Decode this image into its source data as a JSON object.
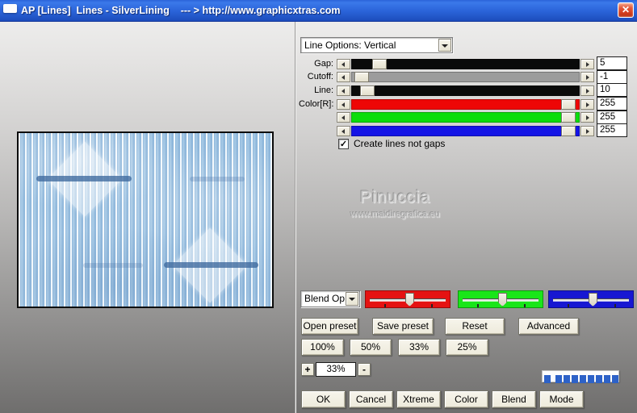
{
  "window": {
    "title": "AP [Lines]  Lines - SilverLining    --- > http://www.graphicxtras.com",
    "close_glyph": "✕"
  },
  "controls": {
    "line_options_dropdown": "Line Options: Vertical",
    "sliders": [
      {
        "label": "Gap:",
        "value": "5",
        "track_color": "#0a0a0a",
        "thumb_left": "9%"
      },
      {
        "label": "Cutoff:",
        "value": "-1",
        "track_color": "#9c9c9c",
        "thumb_left": "1%"
      },
      {
        "label": "Line:",
        "value": "10",
        "track_color": "#0a0a0a",
        "thumb_left": "3.5%"
      },
      {
        "label": "Color[R]:",
        "value": "255",
        "track_color": "#ee0606",
        "thumb_left": "92%"
      },
      {
        "label": "",
        "value": "255",
        "track_color": "#0bdd0b",
        "thumb_left": "92%"
      },
      {
        "label": "",
        "value": "255",
        "track_color": "#1414e6",
        "thumb_left": "92%"
      }
    ],
    "checkbox": {
      "label": "Create lines not gaps",
      "checked": true,
      "mark": "✓"
    }
  },
  "watermark": {
    "name": "Pinuccia",
    "site": "www.maidiregrafica.eu"
  },
  "blend": {
    "dropdown_label": "Blend Opti",
    "channels": [
      {
        "name": "red",
        "color": "#e51212",
        "thumb_left": "47%"
      },
      {
        "name": "green",
        "color": "#19e619",
        "thumb_left": "47%"
      },
      {
        "name": "blue",
        "color": "#1717d2",
        "thumb_left": "47%"
      }
    ]
  },
  "preset_buttons": [
    "Open preset",
    "Save preset",
    "Reset",
    "Advanced"
  ],
  "scale_buttons": [
    "100%",
    "50%",
    "33%",
    "25%"
  ],
  "zoom_control": {
    "plus": "+",
    "value": "33%",
    "minus": "-"
  },
  "progress": {
    "segments": 9,
    "color": "#2d62c8"
  },
  "action_buttons": [
    "OK",
    "Cancel",
    "Xtreme",
    "Color",
    "Blend",
    "Mode"
  ]
}
